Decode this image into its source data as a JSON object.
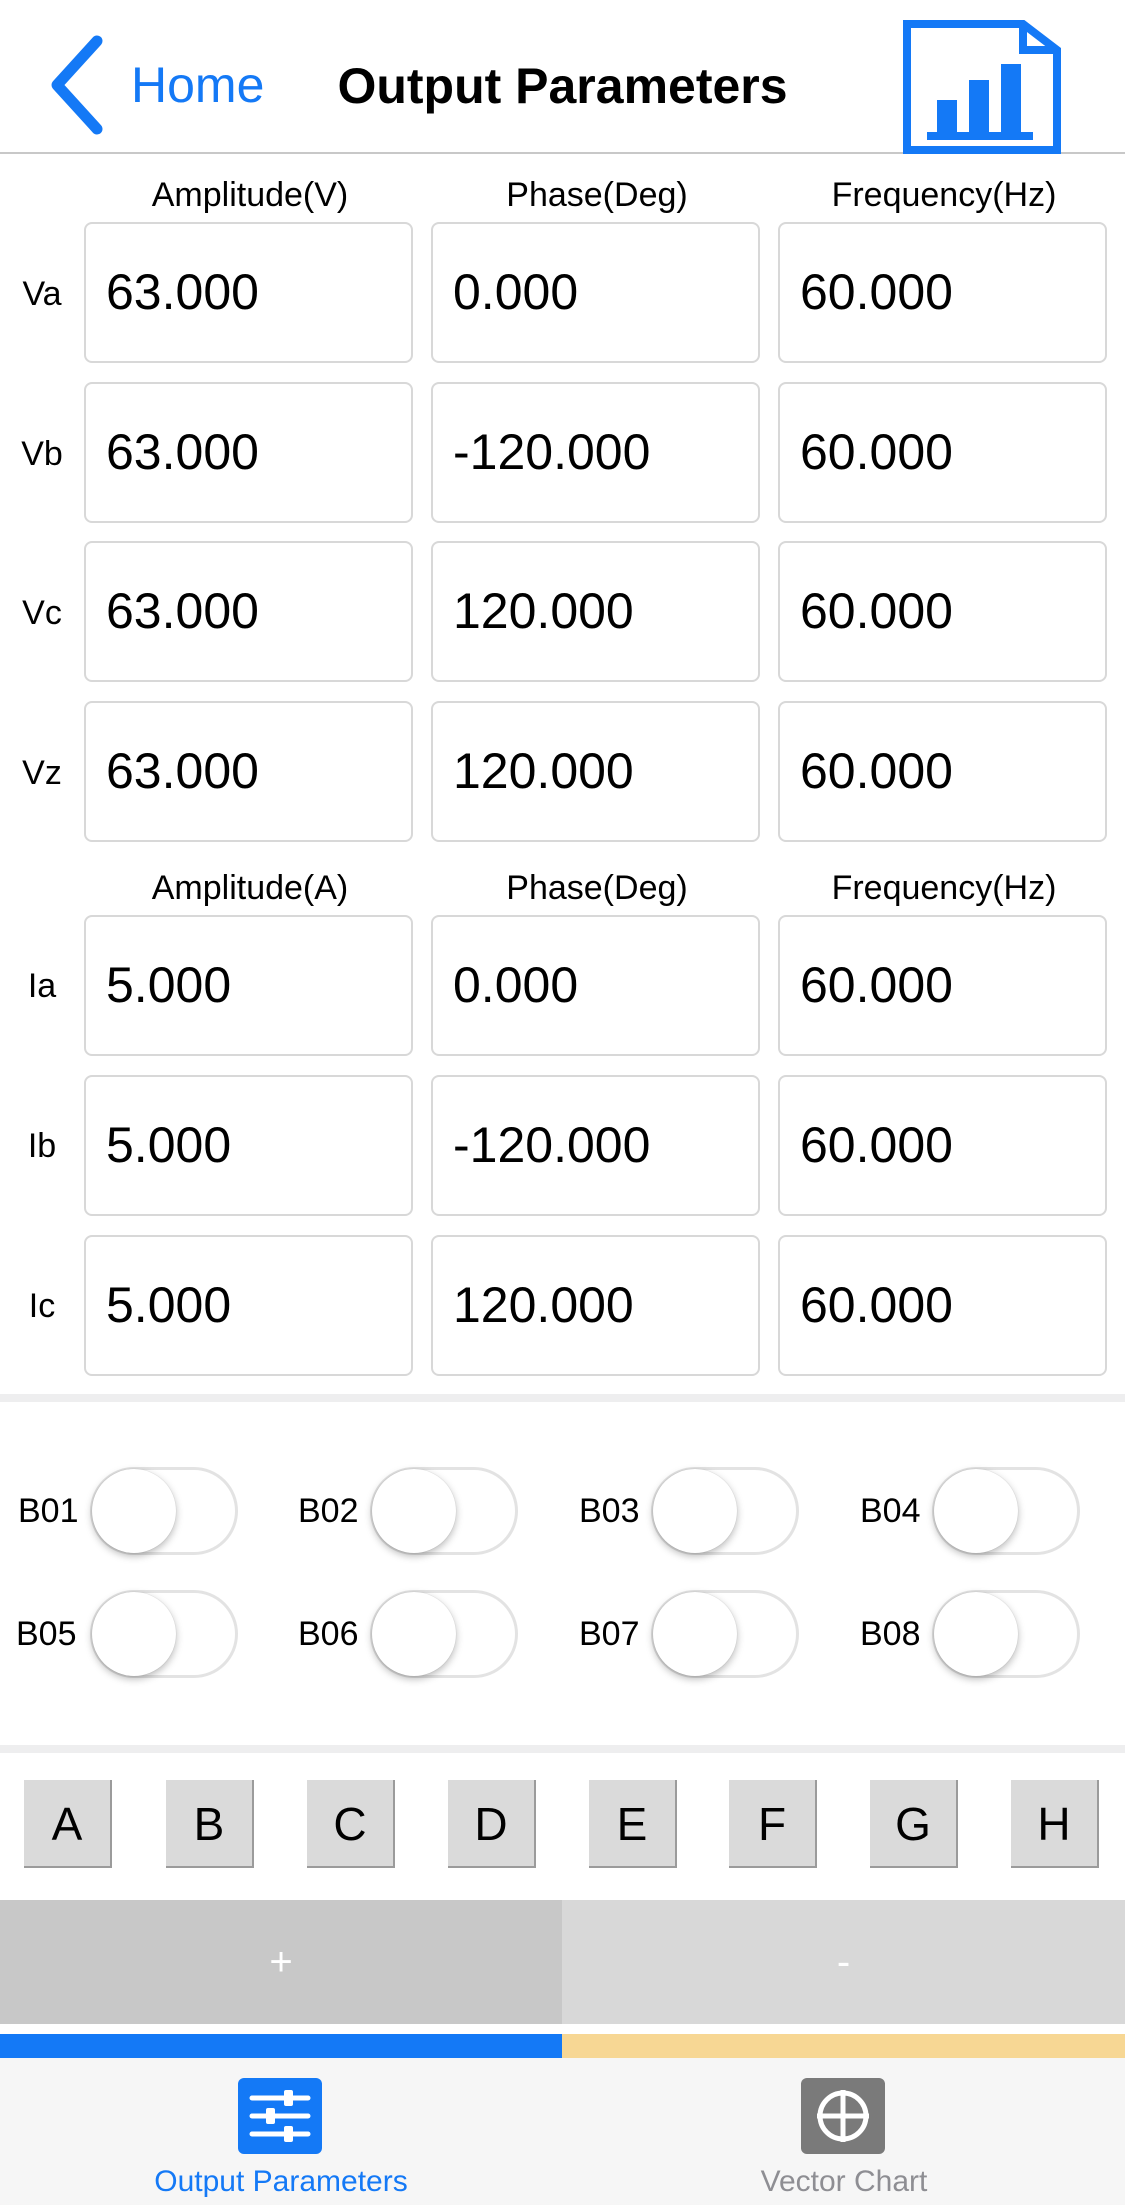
{
  "header": {
    "back_label": "Home",
    "title": "Output Parameters",
    "chart_icon": "bar-chart-document-icon",
    "accent_color": "#1479f6"
  },
  "voltage": {
    "headers": [
      "Amplitude(V)",
      "Phase(Deg)",
      "Frequency(Hz)"
    ],
    "rows": [
      {
        "label": "Va",
        "amplitude": "63.000",
        "phase": "0.000",
        "frequency": "60.000"
      },
      {
        "label": "Vb",
        "amplitude": "63.000",
        "phase": "-120.000",
        "frequency": "60.000"
      },
      {
        "label": "Vc",
        "amplitude": "63.000",
        "phase": "120.000",
        "frequency": "60.000"
      },
      {
        "label": "Vz",
        "amplitude": "63.000",
        "phase": "120.000",
        "frequency": "60.000"
      }
    ]
  },
  "current": {
    "headers": [
      "Amplitude(A)",
      "Phase(Deg)",
      "Frequency(Hz)"
    ],
    "rows": [
      {
        "label": "Ia",
        "amplitude": "5.000",
        "phase": "0.000",
        "frequency": "60.000"
      },
      {
        "label": "Ib",
        "amplitude": "5.000",
        "phase": "-120.000",
        "frequency": "60.000"
      },
      {
        "label": "Ic",
        "amplitude": "5.000",
        "phase": "120.000",
        "frequency": "60.000"
      }
    ]
  },
  "binary_outputs": [
    {
      "label": "B01",
      "on": false
    },
    {
      "label": "B02",
      "on": false
    },
    {
      "label": "B03",
      "on": false
    },
    {
      "label": "B04",
      "on": false
    },
    {
      "label": "B05",
      "on": false
    },
    {
      "label": "B06",
      "on": false
    },
    {
      "label": "B07",
      "on": false
    },
    {
      "label": "B08",
      "on": false
    }
  ],
  "letters": [
    "A",
    "B",
    "C",
    "D",
    "E",
    "F",
    "G",
    "H"
  ],
  "step": {
    "plus_label": "+",
    "minus_label": "-"
  },
  "tabs": [
    {
      "label": "Output Parameters",
      "icon": "sliders-icon",
      "active": true,
      "color": "#1479f6"
    },
    {
      "label": "Vector Chart",
      "icon": "crosshair-icon",
      "active": false,
      "color": "#8e8e93"
    }
  ]
}
